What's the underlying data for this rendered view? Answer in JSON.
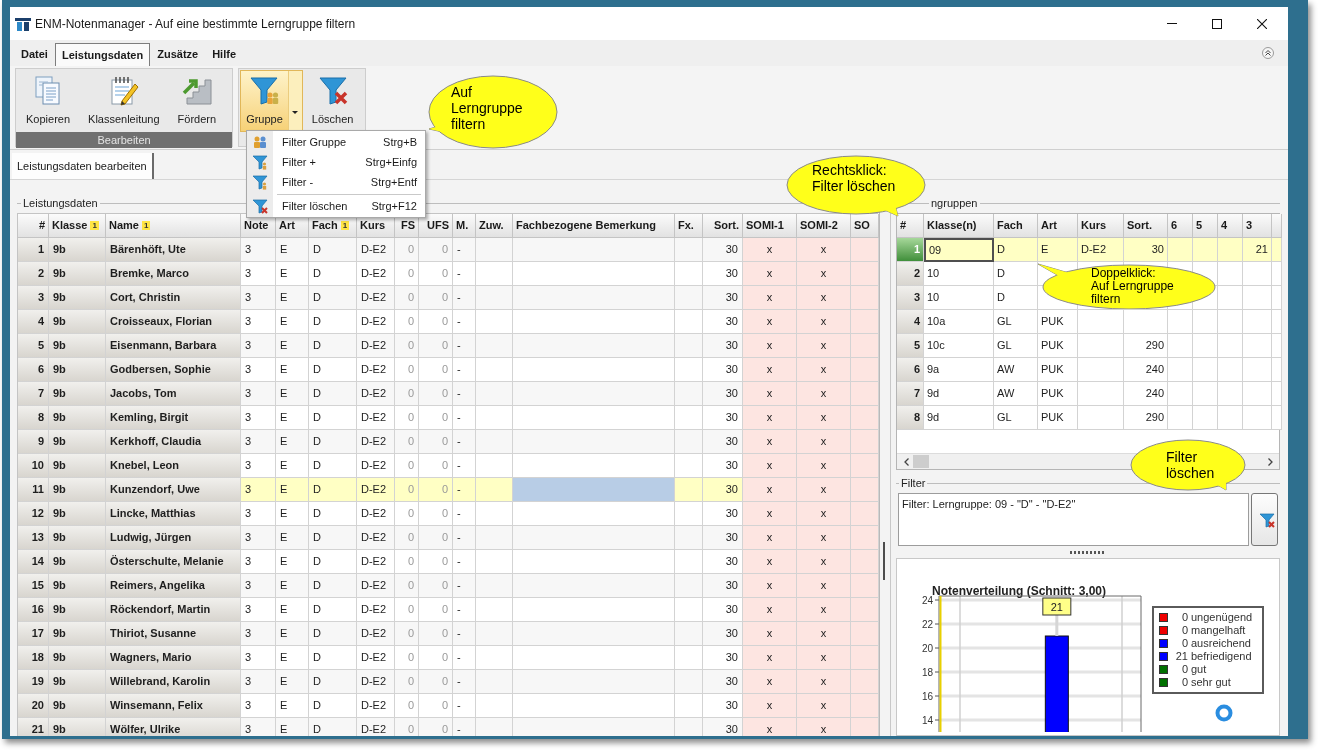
{
  "window": {
    "title": "ENM-Notenmanager - Auf eine bestimmte Lerngruppe filtern"
  },
  "menu_tabs": [
    {
      "label": "Datei",
      "selected": false
    },
    {
      "label": "Leistungsdaten",
      "selected": true
    },
    {
      "label": "Zusätze",
      "selected": false
    },
    {
      "label": "Hilfe",
      "selected": false
    }
  ],
  "ribbon": {
    "groups": [
      {
        "label": "Bearbeiten",
        "buttons": [
          {
            "label": "Kopieren",
            "kind": "copy",
            "pressed": false,
            "dropdown": false
          },
          {
            "label": "Klassenleitung",
            "kind": "notepad",
            "pressed": false,
            "dropdown": false
          },
          {
            "label": "Fördern",
            "kind": "stairs",
            "pressed": false,
            "dropdown": false
          }
        ]
      },
      {
        "buttons": [
          {
            "label": "Gruppe",
            "kind": "filter-group",
            "pressed": true,
            "dropdown": true
          },
          {
            "label": "Löschen",
            "kind": "filter-clear",
            "pressed": false,
            "dropdown": false
          }
        ]
      }
    ]
  },
  "dropdown_menu": {
    "items": [
      {
        "kind": "group",
        "label": "Filter Gruppe",
        "shortcut": "Strg+B"
      },
      {
        "kind": "add",
        "label": "Filter +",
        "shortcut": "Strg+Einfg"
      },
      {
        "kind": "remove",
        "label": "Filter -",
        "shortcut": "Strg+Entf"
      },
      {
        "kind": "separator"
      },
      {
        "kind": "clear",
        "label": "Filter löschen",
        "shortcut": "Strg+F12"
      }
    ]
  },
  "view_tabs": [
    {
      "label": "Leistungsdaten bearbeiten",
      "selected": true
    }
  ],
  "left_panel": {
    "title": "Leistungsdaten",
    "table": {
      "columns": [
        {
          "label": "#"
        },
        {
          "label": "Klasse",
          "sort_rank": "1"
        },
        {
          "label": "Name",
          "sort_rank": "1"
        },
        {
          "label": "Note"
        },
        {
          "label": "Art"
        },
        {
          "label": "Fach",
          "sort_rank": "1"
        },
        {
          "label": "Kurs"
        },
        {
          "label": "FS"
        },
        {
          "label": "UFS"
        },
        {
          "label": "M."
        },
        {
          "label": "Zuw."
        },
        {
          "label": "Fachbezogene Bemerkung"
        },
        {
          "label": "Fx."
        },
        {
          "label": "Sort."
        },
        {
          "label": "SOMI-1"
        },
        {
          "label": "SOMI-2"
        },
        {
          "label": "SO"
        }
      ],
      "rows": [
        {
          "number": "1",
          "klasse": "9b",
          "name": "Bärenhöft, Ute",
          "note": "3",
          "art": "E",
          "fach": "D",
          "kurs": "D-E2",
          "fs": "0",
          "ufs": "0",
          "m": "-",
          "sort": "30",
          "somi_1": "x",
          "somi_2": "x",
          "selected": false
        },
        {
          "number": "2",
          "klasse": "9b",
          "name": "Bremke, Marco",
          "note": "3",
          "art": "E",
          "fach": "D",
          "kurs": "D-E2",
          "fs": "0",
          "ufs": "0",
          "m": "-",
          "sort": "30",
          "somi_1": "x",
          "somi_2": "x",
          "selected": false
        },
        {
          "number": "3",
          "klasse": "9b",
          "name": "Cort, Christin",
          "note": "3",
          "art": "E",
          "fach": "D",
          "kurs": "D-E2",
          "fs": "0",
          "ufs": "0",
          "m": "-",
          "sort": "30",
          "somi_1": "x",
          "somi_2": "x",
          "selected": false
        },
        {
          "number": "4",
          "klasse": "9b",
          "name": "Croisseaux, Florian",
          "note": "3",
          "art": "E",
          "fach": "D",
          "kurs": "D-E2",
          "fs": "0",
          "ufs": "0",
          "m": "-",
          "sort": "30",
          "somi_1": "x",
          "somi_2": "x",
          "selected": false
        },
        {
          "number": "5",
          "klasse": "9b",
          "name": "Eisenmann, Barbara",
          "note": "3",
          "art": "E",
          "fach": "D",
          "kurs": "D-E2",
          "fs": "0",
          "ufs": "0",
          "m": "-",
          "sort": "30",
          "somi_1": "x",
          "somi_2": "x",
          "selected": false
        },
        {
          "number": "6",
          "klasse": "9b",
          "name": "Godbersen, Sophie",
          "note": "3",
          "art": "E",
          "fach": "D",
          "kurs": "D-E2",
          "fs": "0",
          "ufs": "0",
          "m": "-",
          "sort": "30",
          "somi_1": "x",
          "somi_2": "x",
          "selected": false
        },
        {
          "number": "7",
          "klasse": "9b",
          "name": "Jacobs, Tom",
          "note": "3",
          "art": "E",
          "fach": "D",
          "kurs": "D-E2",
          "fs": "0",
          "ufs": "0",
          "m": "-",
          "sort": "30",
          "somi_1": "x",
          "somi_2": "x",
          "selected": false
        },
        {
          "number": "8",
          "klasse": "9b",
          "name": "Kemling, Birgit",
          "note": "3",
          "art": "E",
          "fach": "D",
          "kurs": "D-E2",
          "fs": "0",
          "ufs": "0",
          "m": "-",
          "sort": "30",
          "somi_1": "x",
          "somi_2": "x",
          "selected": false
        },
        {
          "number": "9",
          "klasse": "9b",
          "name": "Kerkhoff, Claudia",
          "note": "3",
          "art": "E",
          "fach": "D",
          "kurs": "D-E2",
          "fs": "0",
          "ufs": "0",
          "m": "-",
          "sort": "30",
          "somi_1": "x",
          "somi_2": "x",
          "selected": false
        },
        {
          "number": "10",
          "klasse": "9b",
          "name": "Knebel, Leon",
          "note": "3",
          "art": "E",
          "fach": "D",
          "kurs": "D-E2",
          "fs": "0",
          "ufs": "0",
          "m": "-",
          "sort": "30",
          "somi_1": "x",
          "somi_2": "x",
          "selected": false
        },
        {
          "number": "11",
          "klasse": "9b",
          "name": "Kunzendorf, Uwe",
          "note": "3",
          "art": "E",
          "fach": "D",
          "kurs": "D-E2",
          "fs": "0",
          "ufs": "0",
          "m": "-",
          "sort": "30",
          "somi_1": "x",
          "somi_2": "x",
          "selected": true
        },
        {
          "number": "12",
          "klasse": "9b",
          "name": "Lincke, Matthias",
          "note": "3",
          "art": "E",
          "fach": "D",
          "kurs": "D-E2",
          "fs": "0",
          "ufs": "0",
          "m": "-",
          "sort": "30",
          "somi_1": "x",
          "somi_2": "x",
          "selected": false
        },
        {
          "number": "13",
          "klasse": "9b",
          "name": "Ludwig, Jürgen",
          "note": "3",
          "art": "E",
          "fach": "D",
          "kurs": "D-E2",
          "fs": "0",
          "ufs": "0",
          "m": "-",
          "sort": "30",
          "somi_1": "x",
          "somi_2": "x",
          "selected": false
        },
        {
          "number": "14",
          "klasse": "9b",
          "name": "Österschulte, Melanie",
          "note": "3",
          "art": "E",
          "fach": "D",
          "kurs": "D-E2",
          "fs": "0",
          "ufs": "0",
          "m": "-",
          "sort": "30",
          "somi_1": "x",
          "somi_2": "x",
          "selected": false
        },
        {
          "number": "15",
          "klasse": "9b",
          "name": "Reimers, Angelika",
          "note": "3",
          "art": "E",
          "fach": "D",
          "kurs": "D-E2",
          "fs": "0",
          "ufs": "0",
          "m": "-",
          "sort": "30",
          "somi_1": "x",
          "somi_2": "x",
          "selected": false
        },
        {
          "number": "16",
          "klasse": "9b",
          "name": "Röckendorf, Martin",
          "note": "3",
          "art": "E",
          "fach": "D",
          "kurs": "D-E2",
          "fs": "0",
          "ufs": "0",
          "m": "-",
          "sort": "30",
          "somi_1": "x",
          "somi_2": "x",
          "selected": false
        },
        {
          "number": "17",
          "klasse": "9b",
          "name": "Thiriot, Susanne",
          "note": "3",
          "art": "E",
          "fach": "D",
          "kurs": "D-E2",
          "fs": "0",
          "ufs": "0",
          "m": "-",
          "sort": "30",
          "somi_1": "x",
          "somi_2": "x",
          "selected": false
        },
        {
          "number": "18",
          "klasse": "9b",
          "name": "Wagners, Mario",
          "note": "3",
          "art": "E",
          "fach": "D",
          "kurs": "D-E2",
          "fs": "0",
          "ufs": "0",
          "m": "-",
          "sort": "30",
          "somi_1": "x",
          "somi_2": "x",
          "selected": false
        },
        {
          "number": "19",
          "klasse": "9b",
          "name": "Willebrand, Karolin",
          "note": "3",
          "art": "E",
          "fach": "D",
          "kurs": "D-E2",
          "fs": "0",
          "ufs": "0",
          "m": "-",
          "sort": "30",
          "somi_1": "x",
          "somi_2": "x",
          "selected": false
        },
        {
          "number": "20",
          "klasse": "9b",
          "name": "Winsemann, Felix",
          "note": "3",
          "art": "E",
          "fach": "D",
          "kurs": "D-E2",
          "fs": "0",
          "ufs": "0",
          "m": "-",
          "sort": "30",
          "somi_1": "x",
          "somi_2": "x",
          "selected": false
        },
        {
          "number": "21",
          "klasse": "9b",
          "name": "Wölfer, Ulrike",
          "note": "3",
          "art": "E",
          "fach": "D",
          "kurs": "D-E2",
          "fs": "0",
          "ufs": "0",
          "m": "-",
          "sort": "30",
          "somi_1": "x",
          "somi_2": "x",
          "selected": false
        }
      ]
    }
  },
  "right_panel": {
    "title": "ngruppen",
    "table": {
      "columns": [
        {
          "label": "#"
        },
        {
          "label": "Klasse(n)"
        },
        {
          "label": "Fach"
        },
        {
          "label": "Art"
        },
        {
          "label": "Kurs"
        },
        {
          "label": "Sort."
        },
        {
          "label": "6"
        },
        {
          "label": "5"
        },
        {
          "label": "4"
        },
        {
          "label": "3"
        }
      ],
      "rows": [
        {
          "number": "1",
          "klasse": "09",
          "fach": "D",
          "art": "E",
          "kurs": "D-E2",
          "sort": "30",
          "col_3": "21",
          "selected": true
        },
        {
          "number": "2",
          "klasse": "10",
          "fach": "D",
          "selected": false
        },
        {
          "number": "3",
          "klasse": "10",
          "fach": "D",
          "selected": false
        },
        {
          "number": "4",
          "klasse": "10a",
          "fach": "GL",
          "art": "PUK",
          "selected": false
        },
        {
          "number": "5",
          "klasse": "10c",
          "fach": "GL",
          "art": "PUK",
          "sort": "290",
          "selected": false
        },
        {
          "number": "6",
          "klasse": "9a",
          "fach": "AW",
          "art": "PUK",
          "sort": "240",
          "selected": false
        },
        {
          "number": "7",
          "klasse": "9d",
          "fach": "AW",
          "art": "PUK",
          "sort": "240",
          "selected": false
        },
        {
          "number": "8",
          "klasse": "9d",
          "fach": "GL",
          "art": "PUK",
          "sort": "290",
          "selected": false
        }
      ]
    },
    "filter": {
      "label": "Filter",
      "text": "Filter: Lerngruppe: 09 - \"D\" - \"D-E2\""
    },
    "chart": {
      "chart_data": {
        "type": "bar",
        "title": "Notenverteilung (Schnitt: 3,00)",
        "values": [
          null,
          null,
          null,
          21,
          null,
          null
        ],
        "value_labels": [
          null,
          null,
          null,
          "21",
          null,
          null
        ],
        "ylim": [
          13,
          24
        ],
        "yticks": [
          14,
          16,
          18,
          20,
          22,
          24
        ],
        "grid": true
      },
      "legend": [
        {
          "count": "0",
          "label": "ungenügend",
          "color": "#ee0000"
        },
        {
          "count": "0",
          "label": "mangelhaft",
          "color": "#ee0000"
        },
        {
          "count": "0",
          "label": "ausreichend",
          "color": "#0000ff"
        },
        {
          "count": "21",
          "label": "befriedigend",
          "color": "#0000ff"
        },
        {
          "count": "0",
          "label": "gut",
          "color": "#007000"
        },
        {
          "count": "0",
          "label": "sehr gut",
          "color": "#007000"
        }
      ]
    }
  },
  "callouts": [
    {
      "text": "Auf\nLerngruppe\nfiltern"
    },
    {
      "text": "Rechtsklick:\nFilter löschen"
    },
    {
      "text": "Doppelklick:\nAuf Lerngruppe\nfiltern"
    },
    {
      "text": "Filter\nlöschen"
    }
  ]
}
